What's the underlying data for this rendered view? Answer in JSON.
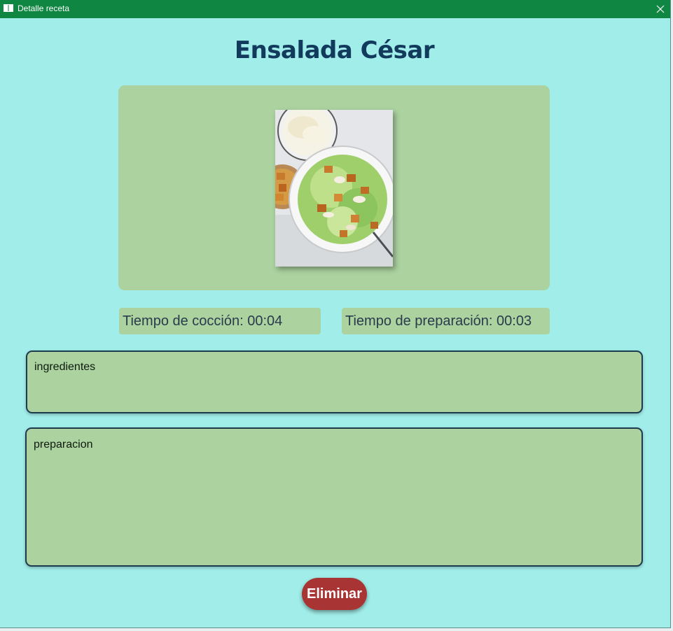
{
  "window": {
    "title": "Detalle receta",
    "title_icon": "window-app-icon",
    "close_icon": "close-icon",
    "titlebar_color": "#0f8641",
    "background_color": "#a1ede9"
  },
  "recipe": {
    "name": "Ensalada César",
    "image_alt": "caesar-salad-photo",
    "cook_time_text": "Tiempo de cocción: 00:04",
    "prep_time_text": "Tiempo de preparación: 00:03",
    "ingredients_placeholder": "ingredientes",
    "preparation_placeholder": "preparacion"
  },
  "actions": {
    "delete_label": "Eliminar"
  },
  "colors": {
    "panel": "#abd29f",
    "title_text": "#123a5c",
    "delete_button": "#a83434"
  }
}
